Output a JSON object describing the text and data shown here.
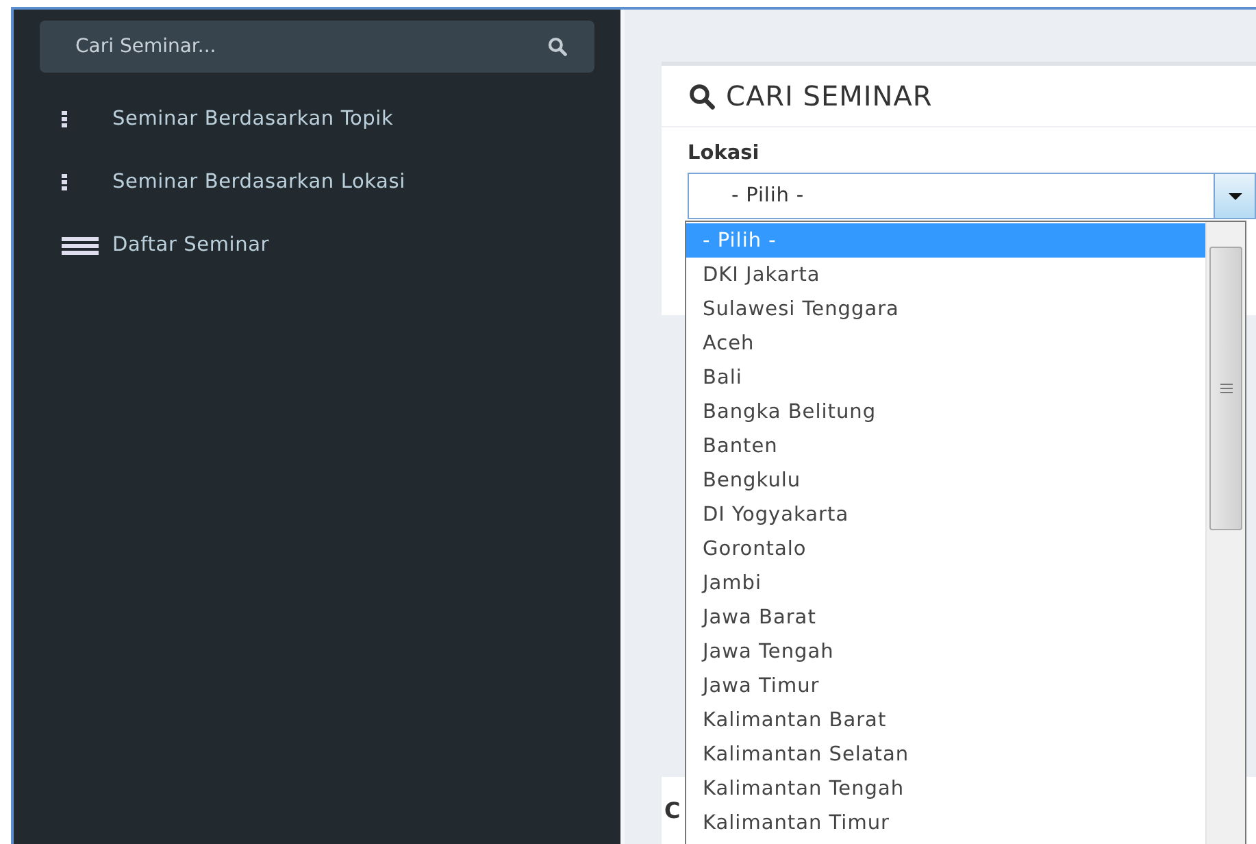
{
  "sidebar": {
    "search": {
      "placeholder": "Cari Seminar..."
    },
    "items": [
      {
        "label": "Seminar Berdasarkan Topik",
        "kind": "dots"
      },
      {
        "label": "Seminar Berdasarkan Lokasi",
        "kind": "dots"
      },
      {
        "label": "Daftar Seminar",
        "kind": "list"
      }
    ]
  },
  "search_card": {
    "title": "CARI SEMINAR",
    "field_label": "Lokasi",
    "select_value": "- Pilih -"
  },
  "dropdown": {
    "options": [
      {
        "label": "- Pilih -",
        "selected": true
      },
      {
        "label": "DKI Jakarta",
        "selected": false
      },
      {
        "label": "Sulawesi Tenggara",
        "selected": false
      },
      {
        "label": "Aceh",
        "selected": false
      },
      {
        "label": "Bali",
        "selected": false
      },
      {
        "label": "Bangka Belitung",
        "selected": false
      },
      {
        "label": "Banten",
        "selected": false
      },
      {
        "label": "Bengkulu",
        "selected": false
      },
      {
        "label": "DI Yogyakarta",
        "selected": false
      },
      {
        "label": "Gorontalo",
        "selected": false
      },
      {
        "label": "Jambi",
        "selected": false
      },
      {
        "label": "Jawa Barat",
        "selected": false
      },
      {
        "label": "Jawa Tengah",
        "selected": false
      },
      {
        "label": "Jawa Timur",
        "selected": false
      },
      {
        "label": "Kalimantan Barat",
        "selected": false
      },
      {
        "label": "Kalimantan Selatan",
        "selected": false
      },
      {
        "label": "Kalimantan Tengah",
        "selected": false
      },
      {
        "label": "Kalimantan Timur",
        "selected": false
      }
    ]
  },
  "lower_card": {
    "heading": "C"
  }
}
